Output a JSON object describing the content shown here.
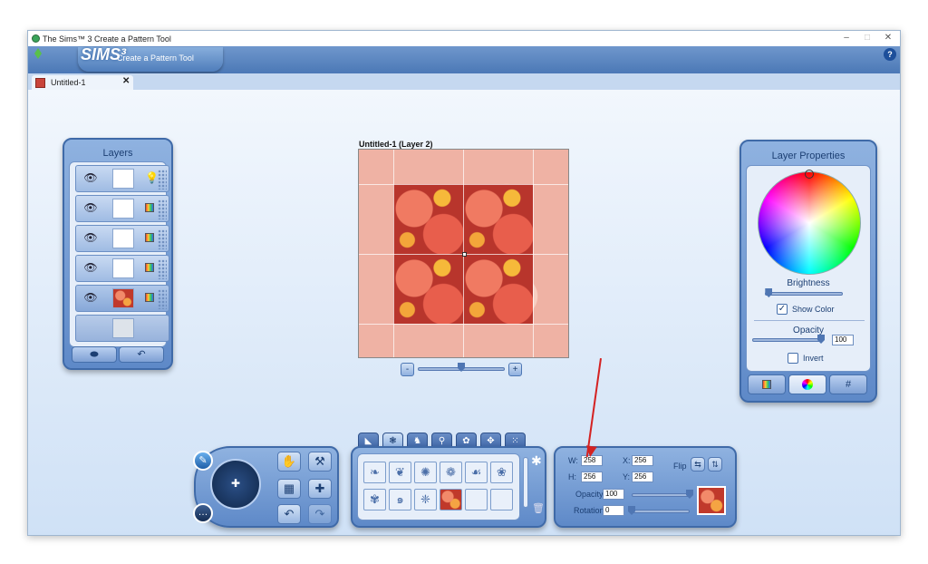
{
  "window": {
    "title": "The Sims™ 3 Create a Pattern Tool",
    "minimize": "–",
    "maximize": "□",
    "close": "✕"
  },
  "header": {
    "logo": "SIMS³",
    "subtitle": "Create a Pattern Tool",
    "help": "?"
  },
  "document_tab": {
    "label": "Untitled-1",
    "close": "✕"
  },
  "layers_panel": {
    "title": "Layers",
    "rows": [
      {
        "eye": "👁",
        "selected": false
      },
      {
        "eye": "👁",
        "selected": false
      },
      {
        "eye": "👁",
        "selected": false
      },
      {
        "eye": "👁",
        "selected": false
      },
      {
        "eye": "👁",
        "selected": true
      }
    ]
  },
  "canvas": {
    "label": "Untitled-1 (Layer 2)",
    "zoom_out": "-",
    "zoom_in": "+",
    "zoom_level": 0.5
  },
  "layer_properties": {
    "title": "Layer Properties",
    "brightness_label": "Brightness",
    "brightness_level": 0.05,
    "show_color_label": "Show Color",
    "show_color_checked": true,
    "opacity_label": "Opacity",
    "opacity_value": "100",
    "opacity_level": 1.0,
    "invert_label": "Invert",
    "invert_checked": false,
    "tab_hash": "#"
  },
  "transform": {
    "w_label": "W:",
    "w_value": "258",
    "h_label": "H:",
    "h_value": "256",
    "x_label": "X:",
    "x_value": "256",
    "y_label": "Y:",
    "y_value": "256",
    "flip_label": "Flip",
    "opacity_label": "Opacity",
    "opacity_value": "100",
    "opacity_level": 1.0,
    "rotation_label": "Rotation",
    "rotation_value": "0",
    "rotation_level": 0.0
  },
  "colors": {
    "accent": "#3f6aa8",
    "panel": "#5e89c8",
    "arrow": "#d42222"
  }
}
